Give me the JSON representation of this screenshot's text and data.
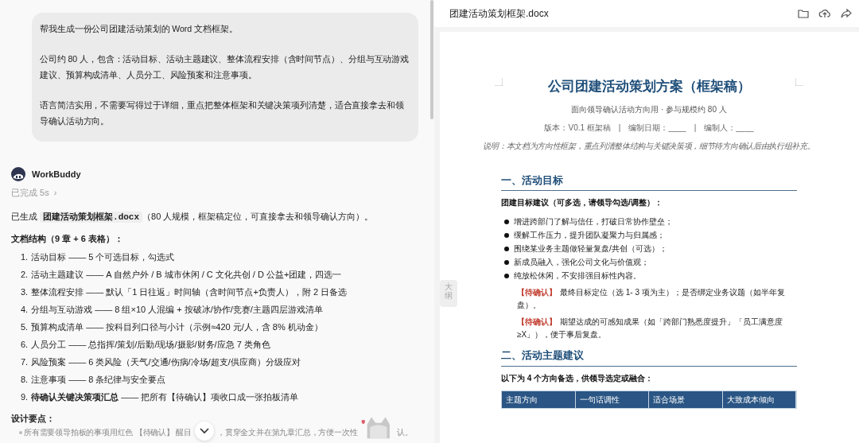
{
  "chat": {
    "user_message": [
      "帮我生成一份公司团建活动策划的 Word 文档框架。",
      "公司约 80 人，包含：活动目标、活动主题建议、整体流程安排（含时间节点）、分组与互动游戏建议、预算构成清单、人员分工、风险预案和注意事项。",
      "语言简洁实用，不需要写得过于详细，重点把整体框架和关键决策项列清楚，适合直接拿去和领导确认活动方向。"
    ],
    "assistant": {
      "name": "WorkBuddy",
      "status": "已完成 5s",
      "status_chevron": "›",
      "intro": {
        "before": "已生成 ",
        "file": "团建活动策划框架.docx",
        "after": "（80 人规模，框架稿定位，可直接拿去和领导确认方向）。"
      },
      "structure_heading": "文档结构（9 章 + 6 表格）：",
      "structure": [
        {
          "number": "1.",
          "text": "活动目标 —— 5 个可选目标，勾选式"
        },
        {
          "number": "2.",
          "text": "活动主题建议 —— A 自然户外 / B 城市休闲 / C 文化共创 / D 公益+团建，四选一"
        },
        {
          "number": "3.",
          "text": "整体流程安排 —— 默认「1 日往返」时间轴（含时间节点+负责人），附 2 日备选"
        },
        {
          "number": "4.",
          "text": "分组与互动游戏 —— 8 组×10 人混编 + 按破冰/协作/竞赛/主题四层游戏清单"
        },
        {
          "number": "5.",
          "text": "预算构成清单 —— 按科目列口径与小计（示例≈420 元/人，含 8% 机动金）"
        },
        {
          "number": "6.",
          "text": "人员分工 —— 总指挥/策划/后勤/现场/摄影/财务/应急 7 类角色"
        },
        {
          "number": "7.",
          "text": "风险预案 —— 6 类风险（天气/交通/伤病/冷场/超支/供应商）分级应对"
        },
        {
          "number": "8.",
          "text": "注意事项 —— 8 条纪律与安全要点"
        },
        {
          "number": "9.",
          "text": "**待确认关键决策项汇总** —— 把所有【待确认】项收口成一张拍板清单"
        }
      ],
      "design_heading": "设计要点：",
      "design_points": [
        {
          "parts": [
            "所有需要领导拍板的事项用红色 【待确认】 醒目",
            "，贯穿全文并在第九章汇总，方便一次性",
            "认。"
          ]
        }
      ]
    }
  },
  "outline_tab": "大纲",
  "document": {
    "file_name": "团建活动策划框架.docx",
    "title": "公司团建活动策划方案（框架稿）",
    "subtitle": "面向领导确认活动方向用 · 参与规模约 80 人",
    "meta": "版本：V0.1 框架稿　|　编制日期：____　|　编制人：____",
    "note": "说明：本文档为方向性框架，重点列清整体结构与关键决策项，细节待方向确认后由执行组补充。",
    "sections": [
      {
        "heading": "一、活动目标",
        "lead": "团建目标建议（可多选，请领导勾选/调整）：",
        "bullets": [
          "增进跨部门了解与信任，打破日常协作壁垒；",
          "缓解工作压力，提升团队凝聚力与归属感；",
          "围绕某业务主题做轻量复盘/共创（可选）；",
          "新成员融入，强化公司文化与价值观；",
          "纯放松休闲，不安排强目标性内容。"
        ],
        "pending": [
          {
            "tag": "【待确认】",
            "text": "最终目标定位（选 1- 3 项为主）；是否绑定业务议题（如半年复盘）。"
          },
          {
            "tag": "【待确认】",
            "text": "期望达成的可感知成果（如「跨部门熟悉度提升」「员工满意度≥X」），便于事后复盘。"
          }
        ]
      },
      {
        "heading": "二、活动主题建议",
        "lead": "以下为 4 个方向备选，供领导选定或融合：",
        "table_columns": [
          "主题方向",
          "一句话调性",
          "适合场景",
          "大致成本倾向"
        ]
      }
    ]
  }
}
